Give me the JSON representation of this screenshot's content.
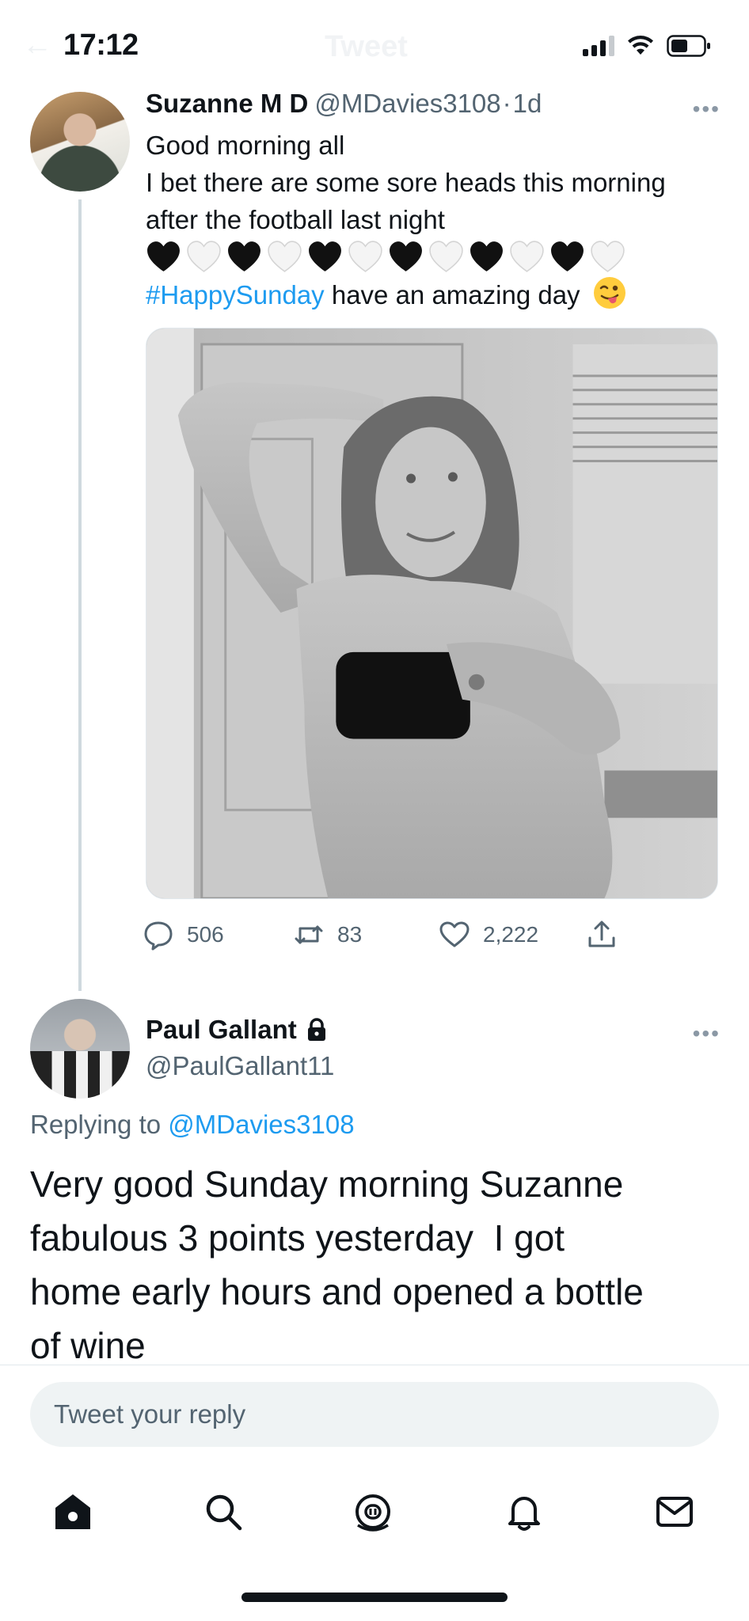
{
  "status_bar": {
    "time": "17:12",
    "faded_back_arrow": "←",
    "faded_title": "Tweet",
    "icons": [
      "cellular-signal-icon",
      "wifi-icon",
      "battery-icon"
    ]
  },
  "main_tweet": {
    "display_name": "Suzanne M D",
    "handle": "@MDavies3108",
    "separator": "·",
    "age": "1d",
    "more_label": "•••",
    "lines": [
      "Good morning all",
      "I bet there are some sore heads this morning",
      "after the football last night"
    ],
    "hearts": [
      "black",
      "white",
      "black",
      "white",
      "black",
      "white",
      "black",
      "white",
      "black",
      "white",
      "black",
      "white"
    ],
    "hashtag": "#HappySunday",
    "tail": " have an amazing day",
    "emoji": "winking-face-with-tongue",
    "photo": "black-and-white mirror selfie photo",
    "replies": "506",
    "retweets": "83",
    "likes": "2,222"
  },
  "reply": {
    "display_name": "Paul Gallant",
    "protected_icon": "lock-icon",
    "handle": "@PaulGallant11",
    "more_label": "•••",
    "replying_prefix": "Replying to",
    "replying_handle": "@MDavies3108",
    "lines": [
      "Very good Sunday morning Suzanne",
      "fabulous 3 points yesterday  I got",
      "home early hours and opened a bottle",
      "of wine"
    ]
  },
  "composer": {
    "placeholder": "Tweet your reply"
  },
  "tabbar": {
    "tabs": [
      "home-icon",
      "search-icon",
      "spaces-icon",
      "notifications-icon",
      "messages-icon"
    ]
  },
  "colors": {
    "accent": "#1d9bf0",
    "text": "#0f1419",
    "secondary": "#536471",
    "thread_line": "#cfd9de",
    "composer_bg": "#eff3f4"
  }
}
